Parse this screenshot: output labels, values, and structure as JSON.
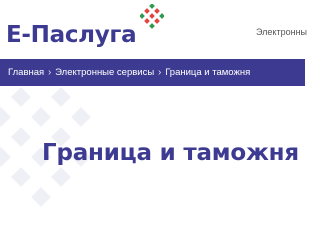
{
  "header": {
    "logo_text": "Е-Паслуга",
    "logo_icon": "ornament-logo-icon",
    "nav_link": "Электронны"
  },
  "breadcrumb": {
    "items": [
      {
        "label": "Главная"
      },
      {
        "label": "Электронные сервисы"
      },
      {
        "label": "Граница и таможня"
      }
    ],
    "separator": "›"
  },
  "main": {
    "title": "Граница и таможня"
  },
  "colors": {
    "brand": "#3d3a91",
    "accent_red": "#e0463f",
    "accent_green": "#2e9a4a",
    "decor": "#eef0f6"
  }
}
